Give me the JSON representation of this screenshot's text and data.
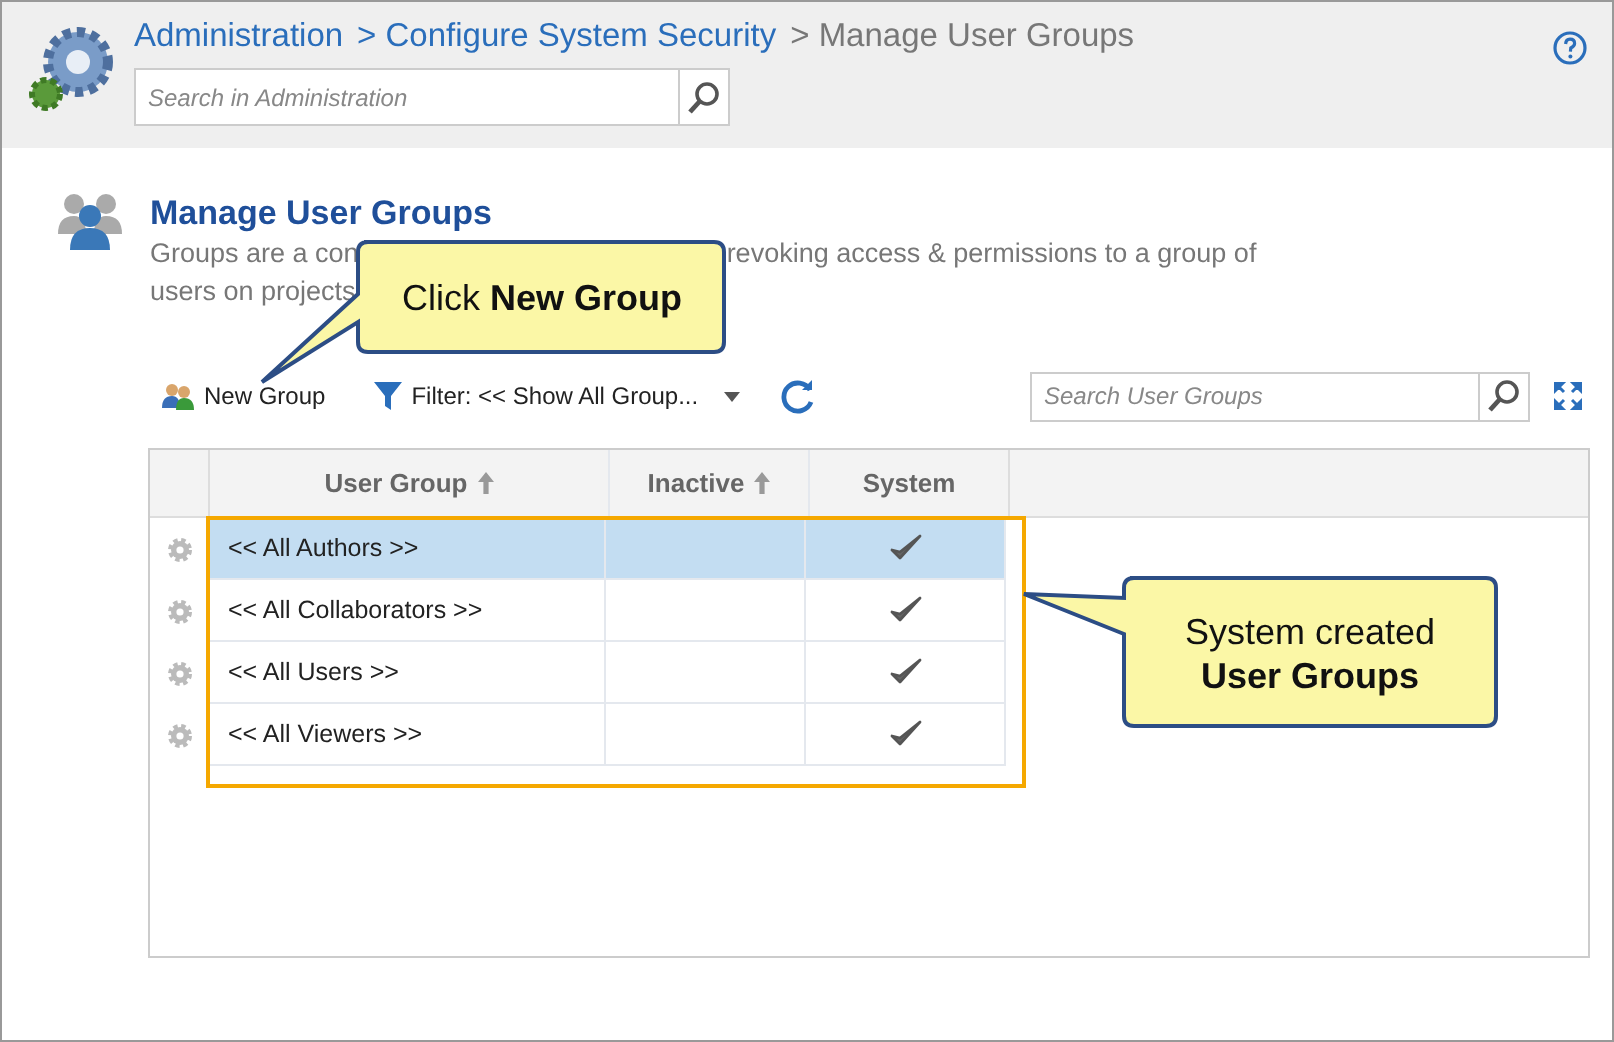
{
  "breadcrumb": [
    {
      "label": "Administration",
      "kind": "link"
    },
    {
      "label": "> Configure System Security",
      "kind": "link"
    },
    {
      "label": "> Manage User Groups",
      "kind": "current"
    }
  ],
  "admin_search": {
    "placeholder": "Search in Administration"
  },
  "page": {
    "title": "Manage User Groups",
    "description_parts": [
      "Groups are a con",
      "revoking access & permissions to a group of"
    ],
    "description_line_2": "users on projects"
  },
  "toolbar": {
    "new_group": "New Group",
    "filter": "Filter: << Show All Group...",
    "search": {
      "placeholder": "Search User Groups"
    }
  },
  "table": {
    "columns": [
      {
        "label": "User Group",
        "sortable": true
      },
      {
        "label": "Inactive",
        "sortable": true
      },
      {
        "label": "System",
        "sortable": false
      }
    ],
    "rows": [
      {
        "name": "<< All Authors >>",
        "selected": true,
        "system": true
      },
      {
        "name": "<< All Collaborators >>",
        "selected": false,
        "system": true
      },
      {
        "name": "<< All Users >>",
        "selected": false,
        "system": true
      },
      {
        "name": "<< All Viewers >>",
        "selected": false,
        "system": true
      }
    ]
  },
  "callouts": [
    {
      "text": "Click **New Group**"
    },
    {
      "text": "System created",
      "bold_text": "User Groups"
    }
  ]
}
